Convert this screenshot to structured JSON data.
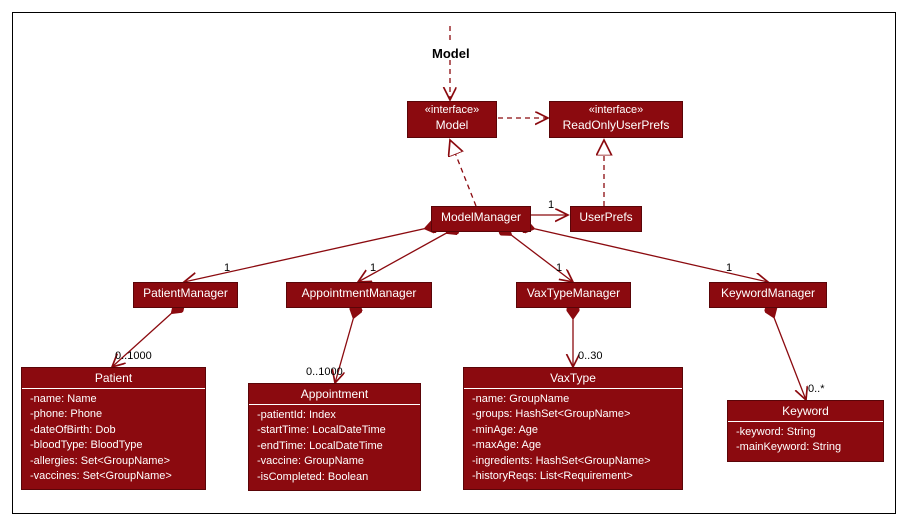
{
  "title": "Model",
  "interfaces": {
    "model": {
      "stereotype": "«interface»",
      "name": "Model"
    },
    "userprefs": {
      "stereotype": "«interface»",
      "name": "ReadOnlyUserPrefs"
    }
  },
  "classes": {
    "modelmanager": {
      "name": "ModelManager"
    },
    "userprefs": {
      "name": "UserPrefs"
    },
    "patientmanager": {
      "name": "PatientManager"
    },
    "appointmentmanager": {
      "name": "AppointmentManager"
    },
    "vaxtypemanager": {
      "name": "VaxTypeManager"
    },
    "keywordmanager": {
      "name": "KeywordManager"
    },
    "patient": {
      "name": "Patient",
      "attrs": [
        "-name: Name",
        "-phone: Phone",
        "-dateOfBirth: Dob",
        "-bloodType: BloodType",
        "-allergies: Set<GroupName>",
        "-vaccines: Set<GroupName>"
      ]
    },
    "appointment": {
      "name": "Appointment",
      "attrs": [
        "-patientId: Index",
        "-startTime: LocalDateTime",
        "-endTime: LocalDateTime",
        "-vaccine: GroupName",
        "-isCompleted: Boolean"
      ]
    },
    "vaxtype": {
      "name": "VaxType",
      "attrs": [
        "-name: GroupName",
        "-groups: HashSet<GroupName>",
        "-minAge: Age",
        "-maxAge: Age",
        "-ingredients: HashSet<GroupName>",
        "-historyReqs: List<Requirement>"
      ]
    },
    "keyword": {
      "name": "Keyword",
      "attrs": [
        "-keyword: String",
        "-mainKeyword: String"
      ]
    }
  },
  "cardinalities": {
    "mm_userprefs": "1",
    "mm_pm": "1",
    "mm_am": "1",
    "mm_vm": "1",
    "mm_km": "1",
    "pm_patient": "0..1000",
    "am_appt": "0..1000",
    "vm_vax": "0..30",
    "km_kw": "0..*"
  }
}
